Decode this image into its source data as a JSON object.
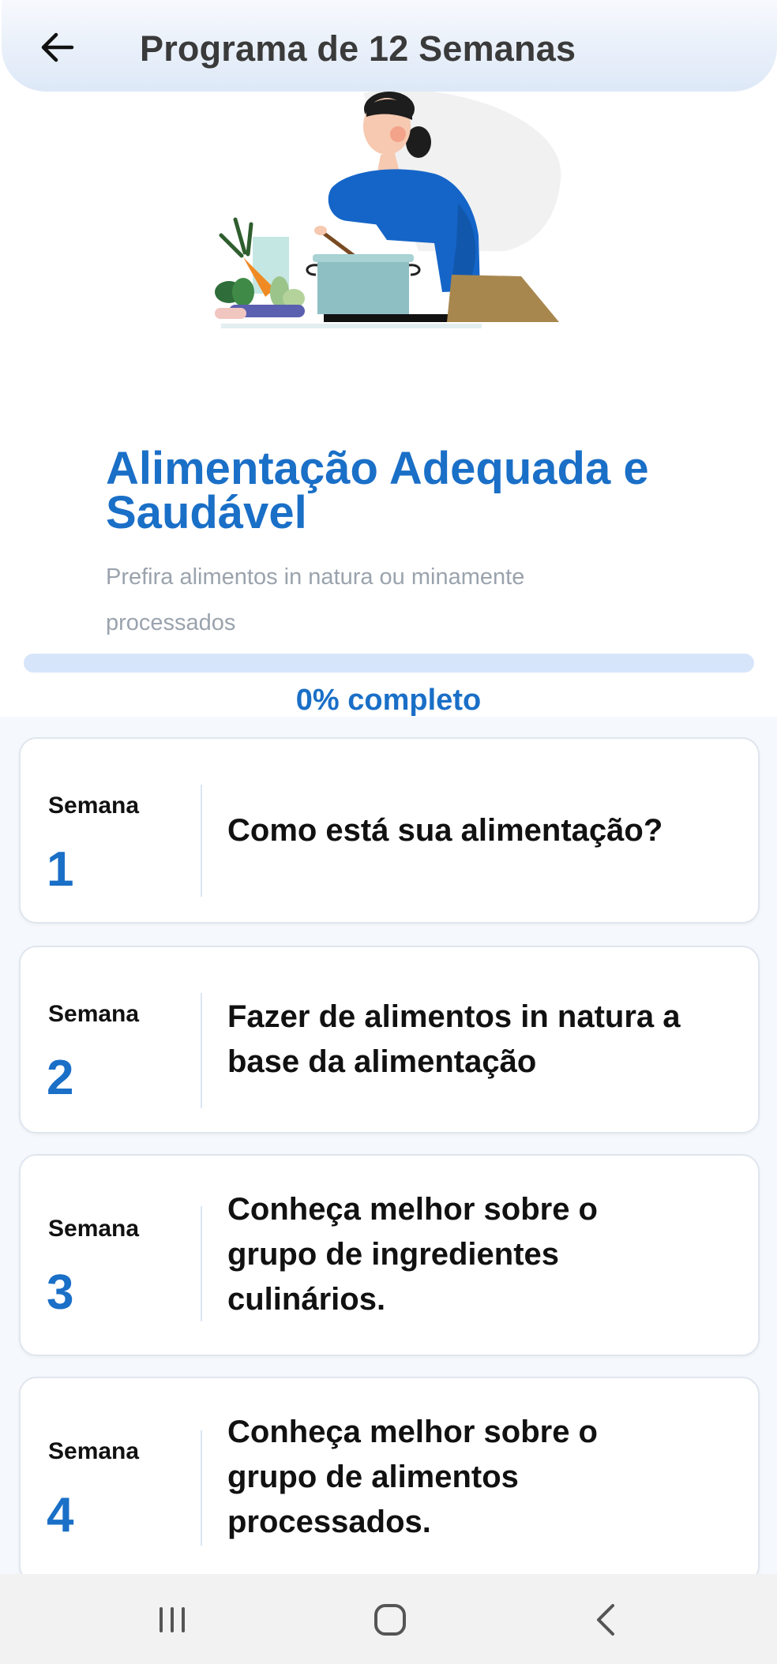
{
  "header": {
    "title": "Programa de 12 Semanas",
    "back_icon": "arrow-left-icon"
  },
  "module": {
    "title": "Alimentação Adequada e Saudável",
    "subtitle": "Prefira alimentos in natura ou minamente processados"
  },
  "progress": {
    "value": 0,
    "label": "0% completo"
  },
  "weeks": [
    {
      "label": "Semana",
      "number": "1",
      "title": "Como está sua alimentação?"
    },
    {
      "label": "Semana",
      "number": "2",
      "title": "Fazer de alimentos in natura a base da alimentação"
    },
    {
      "label": "Semana",
      "number": "3",
      "title": "Conheça melhor sobre o grupo de ingredientes culinários."
    },
    {
      "label": "Semana",
      "number": "4",
      "title": "Conheça melhor sobre o grupo de alimentos processados."
    }
  ],
  "nav": {
    "recents_icon": "recents-icon",
    "home_icon": "home-icon",
    "back_icon": "chevron-left-icon"
  },
  "colors": {
    "accent": "#1a6fc7",
    "progress_track": "#d7e5fa",
    "list_background": "#f5f8fc"
  }
}
